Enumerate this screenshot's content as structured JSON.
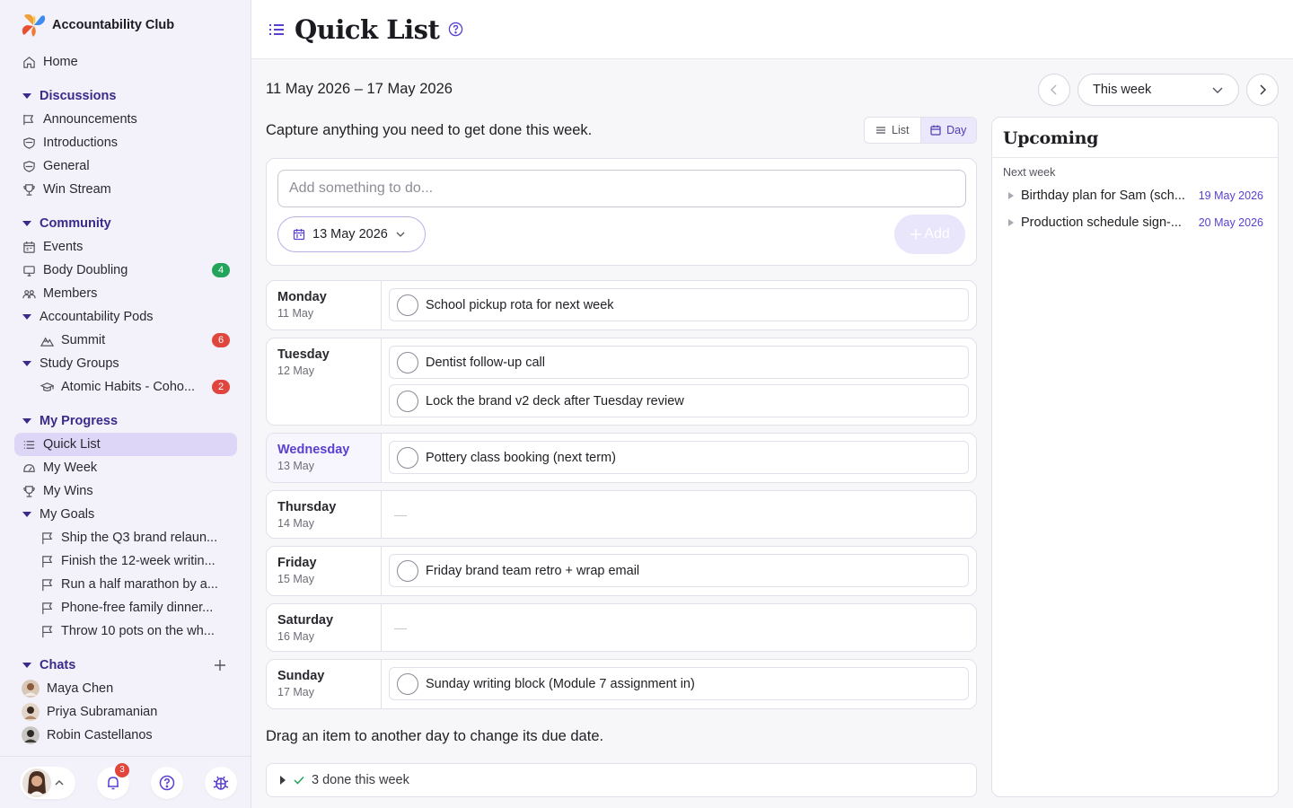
{
  "app": {
    "name": "Accountability Club"
  },
  "nav": {
    "home": "Home",
    "discussions": {
      "label": "Discussions",
      "items": [
        "Announcements",
        "Introductions",
        "General",
        "Win Stream"
      ]
    },
    "community": {
      "label": "Community",
      "events": "Events",
      "body_doubling": {
        "label": "Body Doubling",
        "badge": "4"
      },
      "members": "Members",
      "pods": {
        "label": "Accountability Pods",
        "summit": "Summit",
        "summit_badge": "6"
      },
      "study": {
        "label": "Study Groups",
        "atomic": "Atomic Habits - Coho...",
        "atomic_badge": "2"
      }
    },
    "progress": {
      "label": "My Progress",
      "quick_list": "Quick List",
      "my_week": "My Week",
      "my_wins": "My Wins",
      "my_goals": "My Goals",
      "goals": [
        "Ship the Q3 brand relaun...",
        "Finish the 12-week writin...",
        "Run a half marathon by a...",
        "Phone-free family dinner...",
        "Throw 10 pots on the wh..."
      ]
    },
    "chats": {
      "label": "Chats",
      "people": [
        "Maya Chen",
        "Priya Subramanian",
        "Robin Castellanos"
      ]
    }
  },
  "footer": {
    "notification_count": "3"
  },
  "header": {
    "title": "Quick List"
  },
  "week": {
    "range": "11 May 2026 – 17 May 2026",
    "select": "This week"
  },
  "main": {
    "subtitle": "Capture anything you need to get done this week.",
    "view_list": "List",
    "view_day": "Day",
    "add_placeholder": "Add something to do...",
    "add_date": "13 May 2026",
    "add_button": "Add",
    "hint": "Drag an item to another day to change its due date.",
    "done_summary": "3 done this week"
  },
  "days": [
    {
      "name": "Monday",
      "date": "11 May",
      "tasks": [
        "School pickup rota for next week"
      ]
    },
    {
      "name": "Tuesday",
      "date": "12 May",
      "tasks": [
        "Dentist follow-up call",
        "Lock the brand v2 deck after Tuesday review"
      ]
    },
    {
      "name": "Wednesday",
      "date": "13 May",
      "tasks": [
        "Pottery class booking (next term)"
      ]
    },
    {
      "name": "Thursday",
      "date": "14 May",
      "tasks": [],
      "empty": "—"
    },
    {
      "name": "Friday",
      "date": "15 May",
      "tasks": [
        "Friday brand team retro + wrap email"
      ]
    },
    {
      "name": "Saturday",
      "date": "16 May",
      "tasks": [],
      "empty": "—"
    },
    {
      "name": "Sunday",
      "date": "17 May",
      "tasks": [
        "Sunday writing block (Module 7 assignment in)"
      ]
    }
  ],
  "upcoming": {
    "title": "Upcoming",
    "group": "Next week",
    "items": [
      {
        "label": "Birthday plan for Sam (sch...",
        "date": "19 May 2026"
      },
      {
        "label": "Production schedule sign-...",
        "date": "20 May 2026"
      }
    ]
  },
  "colors": {
    "accent": "#5a3fd0",
    "sidebar_bg": "#f3f1f9",
    "active_bg": "#ddd6f6",
    "badge_red": "#e0463d",
    "badge_green": "#22a55a"
  },
  "icons": [
    "home-icon",
    "announcement-icon",
    "introduction-icon",
    "general-icon",
    "trophy-icon",
    "calendar-icon",
    "monitor-icon",
    "members-icon",
    "mountain-icon",
    "graduation-cap-icon",
    "list-icon",
    "speedometer-icon",
    "flag-icon",
    "plus-icon",
    "bell-icon",
    "help-icon",
    "bug-icon",
    "chevron-left-icon",
    "chevron-right-icon",
    "chevron-down-icon",
    "check-icon"
  ]
}
